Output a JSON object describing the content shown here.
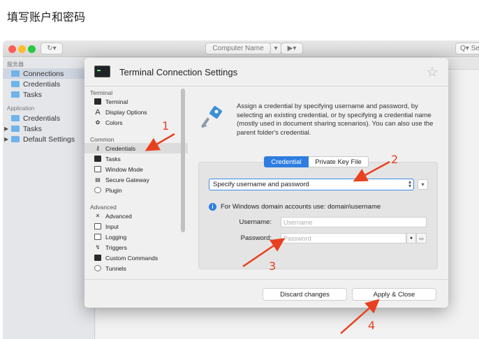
{
  "caption": "填写账户和密码",
  "toolbar": {
    "computer_name_placeholder": "Computer Name",
    "search_label": "Q▾ Se"
  },
  "sidebar": {
    "section_servers": "服务器",
    "servers_items": [
      {
        "label": "Connections",
        "selected": true
      },
      {
        "label": "Credentials"
      },
      {
        "label": "Tasks"
      }
    ],
    "section_application": "Application",
    "application_items": [
      {
        "label": "Credentials"
      },
      {
        "label": "Tasks",
        "expandable": true
      },
      {
        "label": "Default Settings",
        "expandable": true
      }
    ]
  },
  "dialog": {
    "title": "Terminal Connection Settings",
    "nav": {
      "group_terminal": "Terminal",
      "terminal_items": [
        "Terminal",
        "Display Options",
        "Colors"
      ],
      "group_common": "Common",
      "common_items": [
        "Credentials",
        "Tasks",
        "Window Mode",
        "Secure Gateway",
        "Plugin"
      ],
      "group_advanced": "Advanced",
      "advanced_items": [
        "Advanced",
        "Input",
        "Logging",
        "Triggers",
        "Custom Commands",
        "Tunnels"
      ]
    },
    "description": "Assign a credential by specifying username and password, by selecting an existing credential, or by specifying a credential name (mostly used in document sharing scenarios). You can also use the parent folder's credential.",
    "tabs": {
      "credential": "Credential",
      "private_key": "Private Key File"
    },
    "credential_mode": "Specify username and password",
    "info_text": "For Windows domain accounts use: domain\\username",
    "username_label": "Username:",
    "username_placeholder": "Username",
    "password_label": "Password:",
    "password_placeholder": "Password",
    "discard_label": "Discard changes",
    "apply_label": "Apply & Close"
  },
  "annotations": {
    "labels": [
      "1",
      "2",
      "3",
      "4"
    ],
    "color": "#e8411f"
  },
  "colors": {
    "accent": "#2f7de1",
    "folder": "#6fb3ea"
  }
}
